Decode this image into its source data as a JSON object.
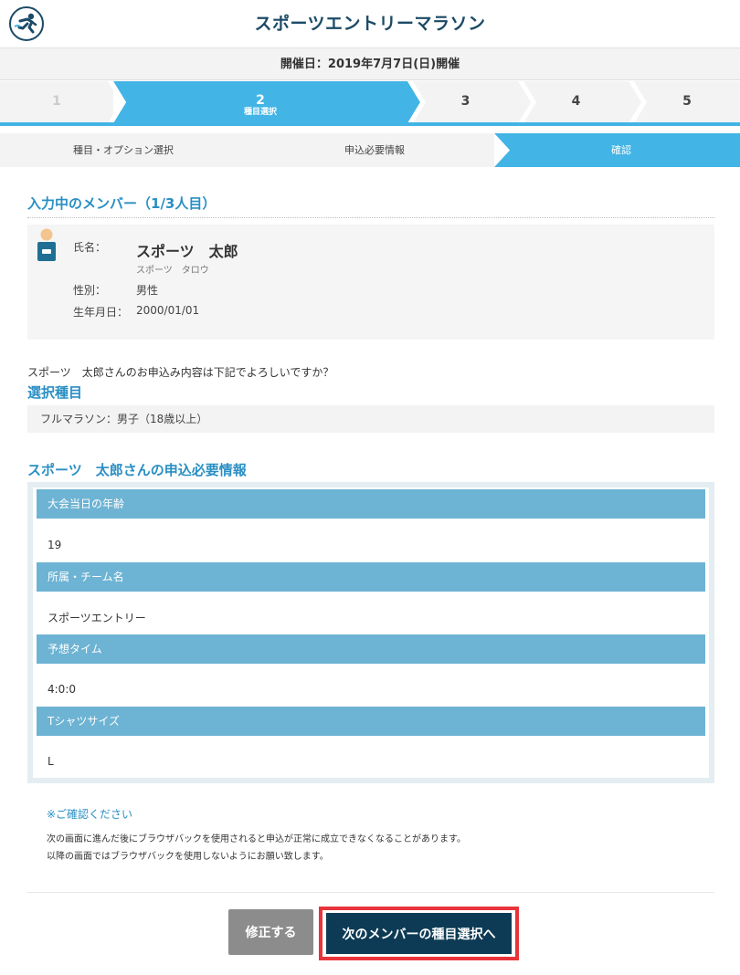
{
  "header": {
    "title": "スポーツエントリーマラソン",
    "event_date": "開催日：2019年7月7日(日)開催"
  },
  "steps": {
    "items": [
      {
        "num": "1",
        "sub": ""
      },
      {
        "num": "2",
        "sub": "種目選択"
      },
      {
        "num": "3",
        "sub": ""
      },
      {
        "num": "4",
        "sub": ""
      },
      {
        "num": "5",
        "sub": ""
      }
    ],
    "active_index": 1
  },
  "substeps": {
    "items": [
      "種目・オプション選択",
      "申込必要情報",
      "確認"
    ],
    "active_index": 2
  },
  "member": {
    "heading": "入力中のメンバー（1/3人目）",
    "name_label": "氏名：",
    "name": "スポーツ　太郎",
    "kana": "スポーツ　タロウ",
    "gender_label": "性別：",
    "gender": "男性",
    "birth_label": "生年月日：",
    "birth": "2000/01/01"
  },
  "confirm_text": "スポーツ　太郎さんのお申込み内容は下記でよろしいですか？",
  "selected_event": {
    "heading": "選択種目",
    "value": "フルマラソン：男子（18歳以上）"
  },
  "required_info": {
    "heading": "スポーツ　太郎さんの申込必要情報",
    "items": [
      {
        "label": "大会当日の年齢",
        "value": "19"
      },
      {
        "label": "所属・チーム名",
        "value": "スポーツエントリー"
      },
      {
        "label": "予想タイム",
        "value": "4:0:0"
      },
      {
        "label": "Tシャツサイズ",
        "value": "L"
      }
    ]
  },
  "notice": {
    "title": "※ご確認ください",
    "line1": "次の画面に進んだ後にブラウザバックを使用されると申込が正常に成立できなくなることがあります。",
    "line2": "以降の画面ではブラウザバックを使用しないようにお願い致します。"
  },
  "buttons": {
    "edit": "修正する",
    "next": "次のメンバーの種目選択へ"
  },
  "colors": {
    "accent": "#42b4e5",
    "heading": "#2a8fc4",
    "title": "#1b4a66",
    "info_header": "#6db3d3",
    "next_button": "#0d3b55",
    "highlight": "#e8343b"
  }
}
